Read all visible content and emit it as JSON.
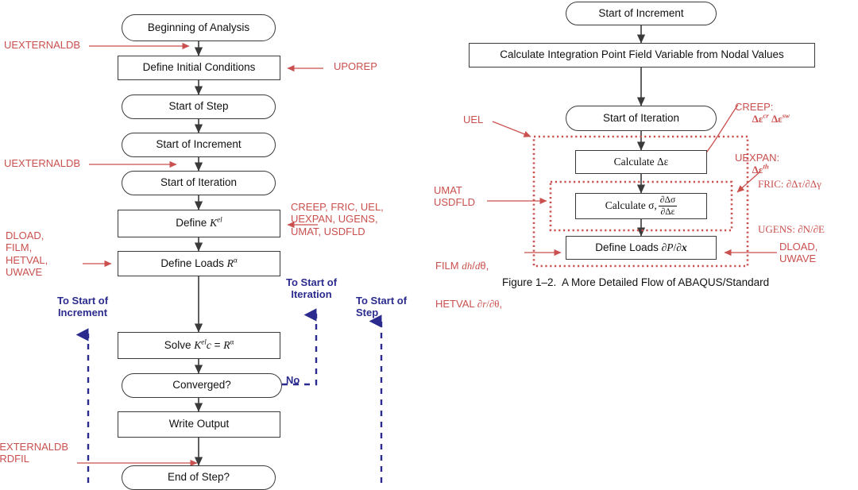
{
  "figure": {
    "caption": "Figure 1–2.  A More Detailed Flow of ABAQUS/Standard"
  },
  "colors": {
    "red": "#c9504e",
    "blue": "#2b2b8f",
    "box_stroke": "#3a3a3a",
    "background": "#ffffff"
  },
  "left_flow": {
    "nodes": [
      {
        "id": "beginning-of-analysis",
        "label": "Beginning of Analysis",
        "shape": "pill"
      },
      {
        "id": "define-initial-conditions",
        "label": "Define Initial Conditions",
        "shape": "rect"
      },
      {
        "id": "start-of-step",
        "label": "Start of Step",
        "shape": "pill"
      },
      {
        "id": "start-of-increment",
        "label": "Start of Increment",
        "shape": "pill"
      },
      {
        "id": "start-of-iteration",
        "label": "Start of Iteration",
        "shape": "pill"
      },
      {
        "id": "define-k-el",
        "label": "Define K",
        "label_sup": "el",
        "shape": "rect"
      },
      {
        "id": "define-loads-r-alpha",
        "label": "Define Loads R",
        "label_sup": "α",
        "shape": "rect"
      },
      {
        "id": "solve-k-el-c-r-alpha",
        "label": "Solve K el c = R α",
        "shape": "rect"
      },
      {
        "id": "converged",
        "label": "Converged?",
        "shape": "pill"
      },
      {
        "id": "write-output",
        "label": "Write Output",
        "shape": "rect"
      },
      {
        "id": "end-of-step",
        "label": "End of Step?",
        "shape": "pill"
      }
    ],
    "red_annotations": [
      {
        "id": "uexternaldb-1",
        "text": "UEXTERNALDB"
      },
      {
        "id": "uporep",
        "text": "UPOREP"
      },
      {
        "id": "uexternaldb-2",
        "text": "UEXTERNALDB"
      },
      {
        "id": "creep-fric-uel-group",
        "text": "CREEP, FRIC, UEL,\nUEXPAN, UGENS,\nUMAT, USDFLD"
      },
      {
        "id": "dload-film-group",
        "text": "DLOAD,\nFILM,\nHETVAL,\nUWAVE"
      },
      {
        "id": "uexternaldb-urdfil",
        "text": "UEXTERNALDB\nURDFIL"
      }
    ],
    "blue_annotations": [
      {
        "id": "to-start-of-increment",
        "text": "To Start of\nIncrement"
      },
      {
        "id": "to-start-of-iteration",
        "text": "To Start of\nIteration"
      },
      {
        "id": "to-start-of-step",
        "text": "To Start of\nStep"
      },
      {
        "id": "no-branch",
        "text": "No"
      }
    ]
  },
  "right_flow": {
    "nodes": [
      {
        "id": "start-of-increment",
        "label": "Start of Increment",
        "shape": "pill"
      },
      {
        "id": "calculate-integration-point",
        "label": "Calculate Integration Point Field Variable from Nodal Values",
        "shape": "rect"
      },
      {
        "id": "start-of-iteration",
        "label": "Start of Iteration",
        "shape": "pill"
      },
      {
        "id": "calculate-delta-epsilon",
        "label": "Calculate  Δε",
        "shape": "rect"
      },
      {
        "id": "calculate-sigma",
        "label": "Calculate σ,",
        "frac_num": "∂Δσ",
        "frac_den": "∂Δε",
        "shape": "rect"
      },
      {
        "id": "define-loads-dp-dx",
        "label": "Define Loads ∂P/∂x",
        "shape": "rect"
      }
    ],
    "red_annotations": [
      {
        "id": "uel",
        "text": "UEL"
      },
      {
        "id": "creep-uexpan",
        "line1_name": "CREEP:",
        "line1_math": "Δε cr  Δε sw",
        "line2_name": "UEXPAN:",
        "line2_math": "Δε th"
      },
      {
        "id": "fric-ugens",
        "line1": "FRIC: ∂Δτ/∂Δγ",
        "line2": "UGENS: ∂N/∂E"
      },
      {
        "id": "umat-usdfld",
        "text": "UMAT\nUSDFLD"
      },
      {
        "id": "film-hetval",
        "line1": "FILM dh/dθ,",
        "line2": "HETVAL ∂r/∂θ,"
      },
      {
        "id": "dload-uwave",
        "text": "DLOAD,\nUWAVE"
      }
    ]
  }
}
